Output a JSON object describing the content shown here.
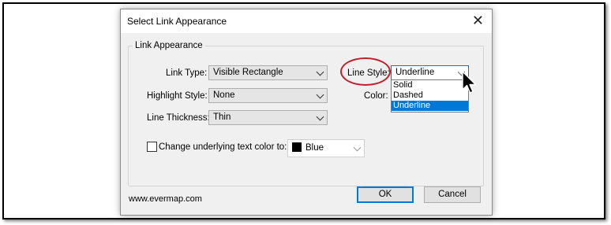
{
  "dialog": {
    "title": "Select Link Appearance",
    "close_glyph": "✕",
    "group_label": "Link Appearance",
    "link_type": {
      "label": "Link Type:",
      "value": "Visible Rectangle"
    },
    "highlight_style": {
      "label": "Highlight Style:",
      "value": "None"
    },
    "line_thickness": {
      "label": "Line Thickness:",
      "value": "Thin"
    },
    "line_style": {
      "label": "Line Style:",
      "value": "Underline",
      "options": [
        "Solid",
        "Dashed",
        "Underline"
      ],
      "selected_index": 2
    },
    "color_label": "Color:",
    "change_text_color": {
      "label": "Change underlying text color to:",
      "checked": false
    },
    "text_color": {
      "value": "Blue",
      "swatch": "#000000"
    },
    "website": "www.evermap.com",
    "ok_label": "OK",
    "cancel_label": "Cancel"
  },
  "colors": {
    "highlight": "#0078d7",
    "annotation_circle": "#c0202a"
  }
}
